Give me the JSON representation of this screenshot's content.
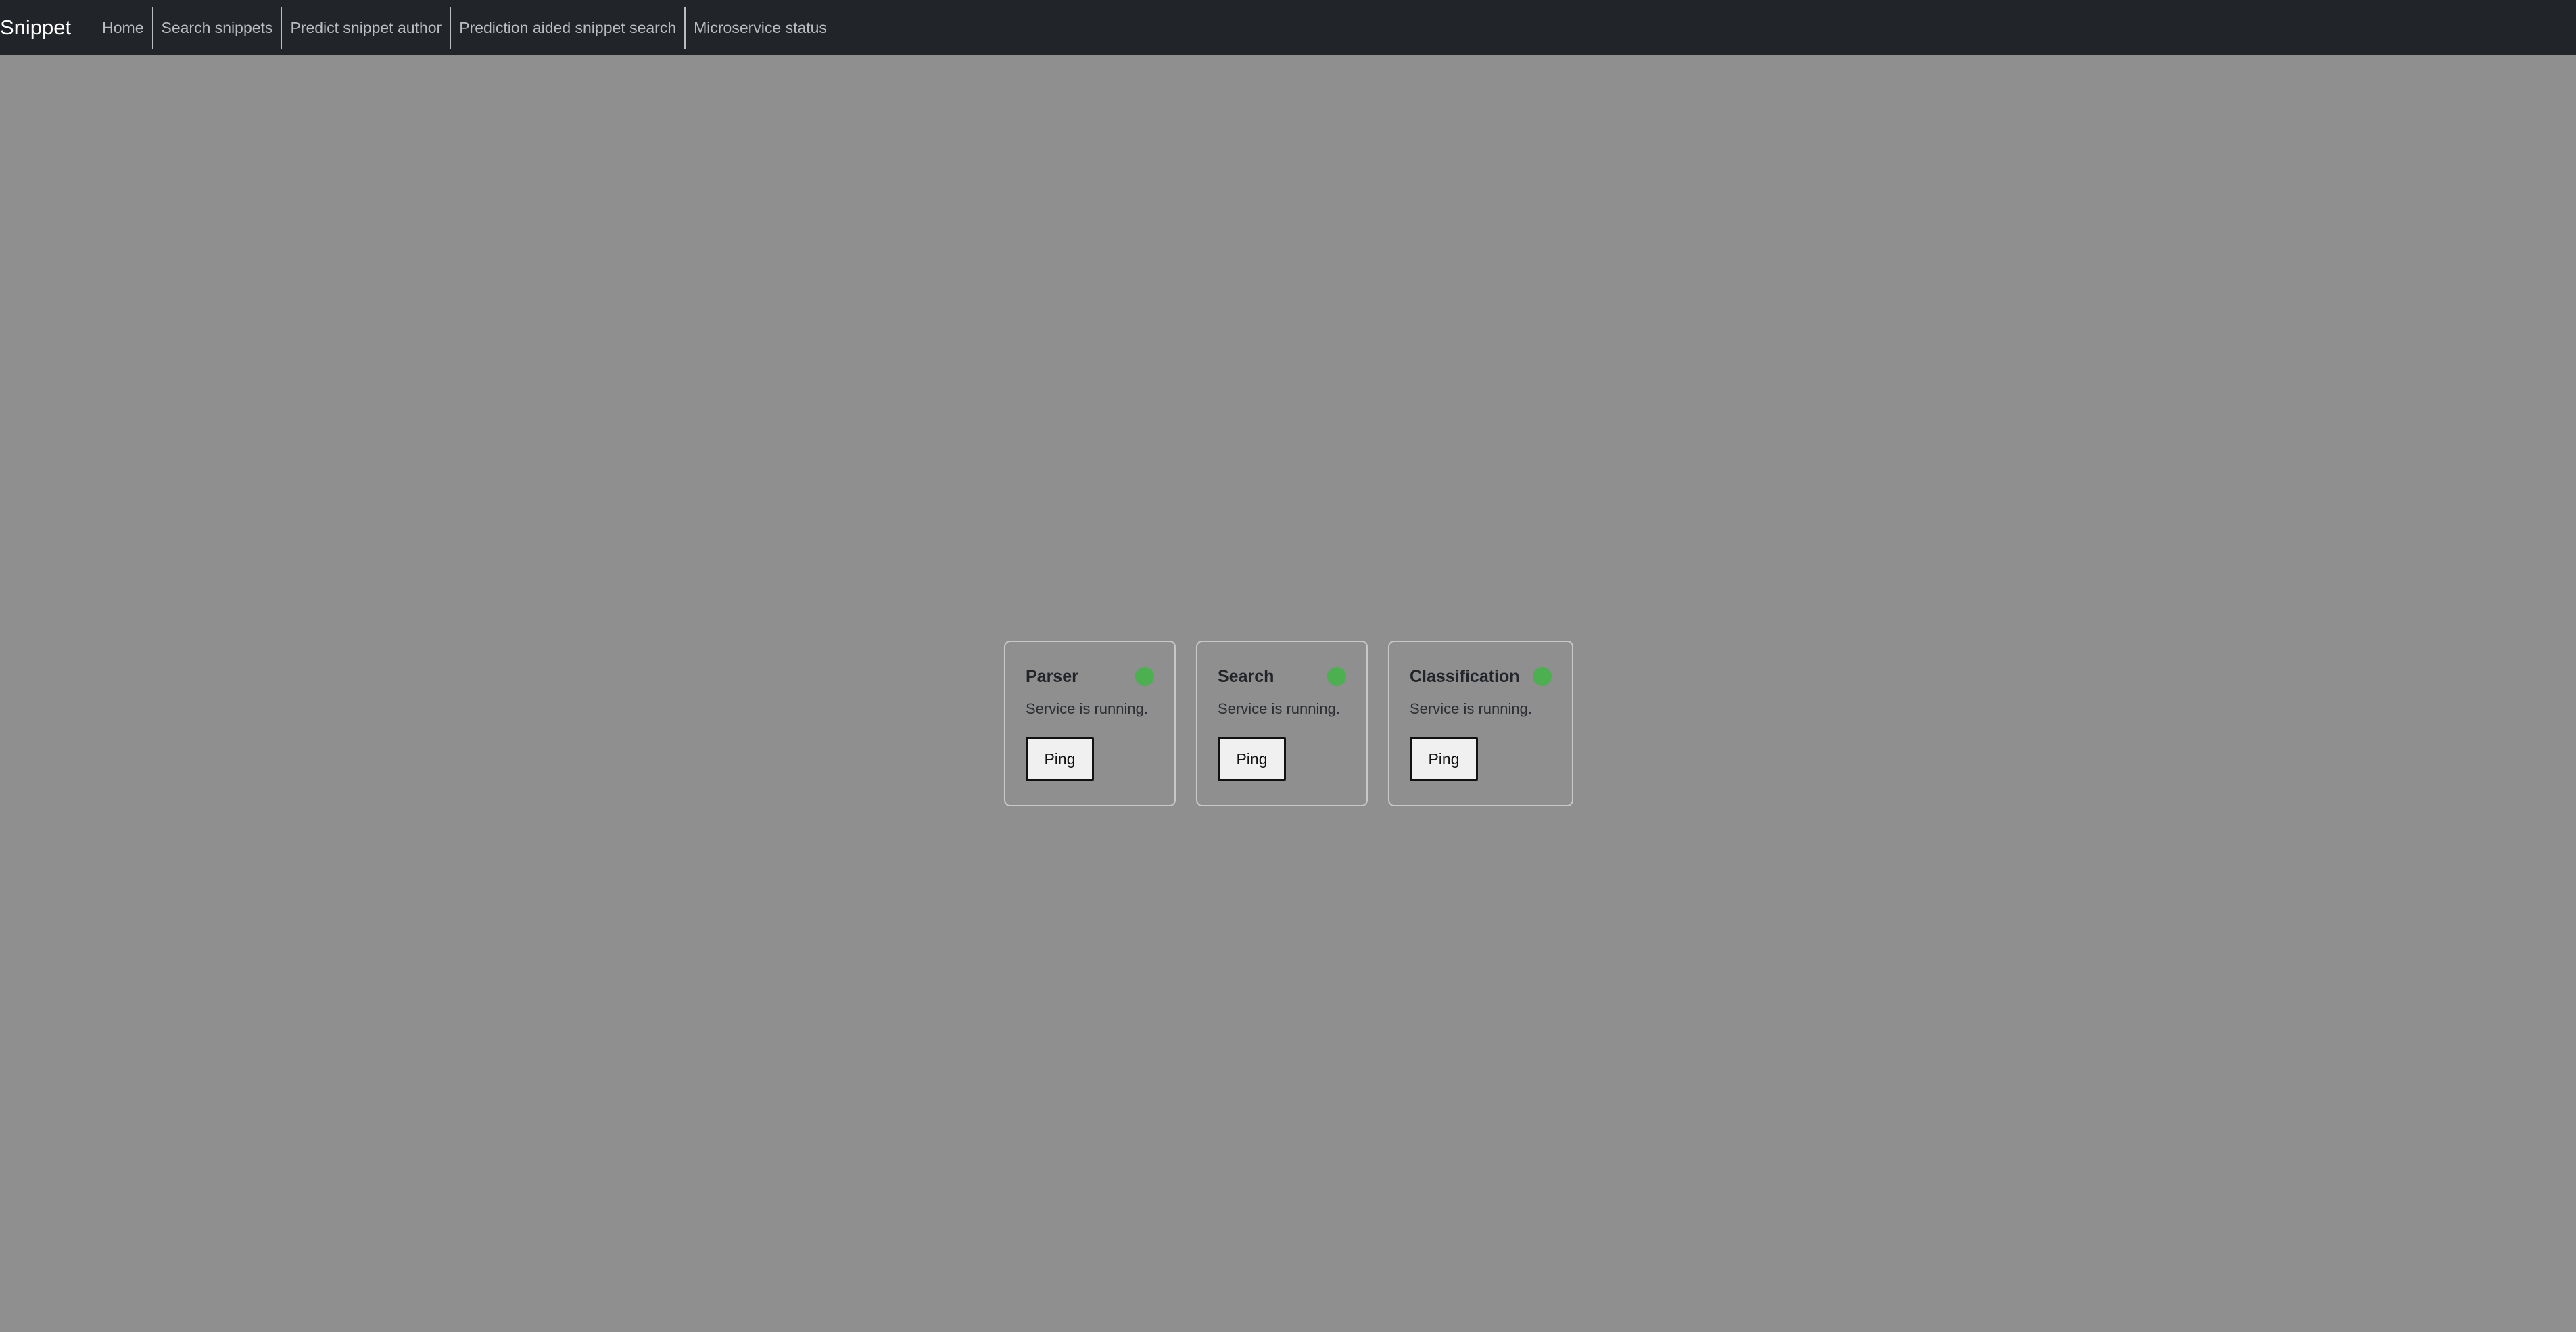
{
  "navbar": {
    "brand": "Snippet",
    "links": [
      {
        "label": "Home"
      },
      {
        "label": "Search snippets"
      },
      {
        "label": "Predict snippet author"
      },
      {
        "label": "Prediction aided snippet search"
      },
      {
        "label": "Microservice status"
      }
    ]
  },
  "services": [
    {
      "name": "Parser",
      "status_text": "Service is running.",
      "status_color": "#4caf50",
      "button_label": "Ping"
    },
    {
      "name": "Search",
      "status_text": "Service is running.",
      "status_color": "#4caf50",
      "button_label": "Ping"
    },
    {
      "name": "Classification",
      "status_text": "Service is running.",
      "status_color": "#4caf50",
      "button_label": "Ping"
    }
  ],
  "colors": {
    "navbar_bg": "#212529",
    "page_bg": "#8f8f8f",
    "status_running": "#4caf50"
  }
}
